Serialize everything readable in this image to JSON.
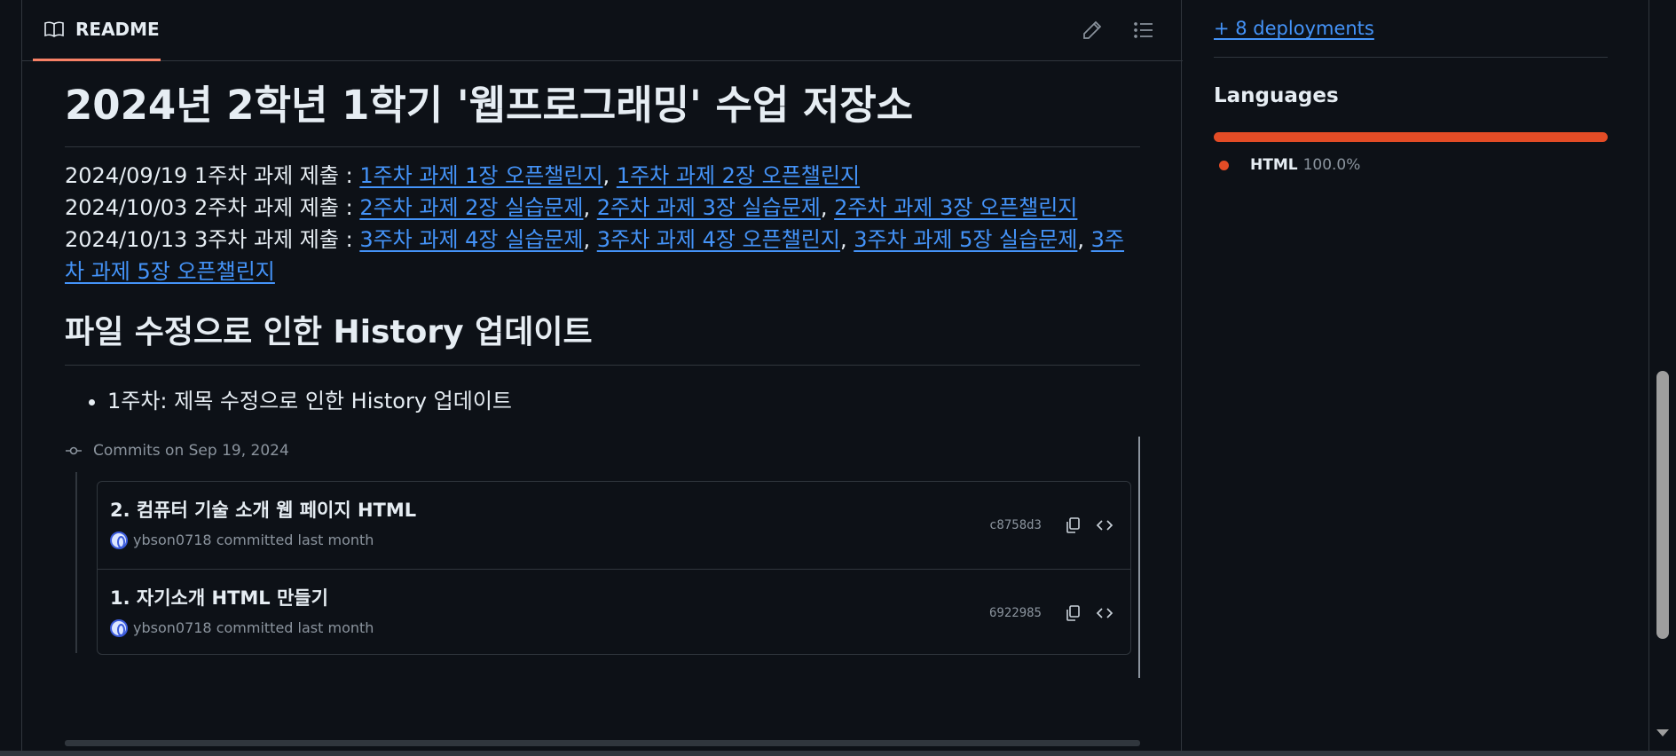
{
  "readme": {
    "tab_label": "README",
    "tab_icon": "book-icon",
    "edit_icon": "pencil-icon",
    "outline_icon": "list-icon"
  },
  "content": {
    "title": "2024년 2학년 1학기 '웹프로그래밍' 수업 저장소",
    "homework": [
      {
        "prefix": "2024/09/19 1주차 과제 제출 : ",
        "links": [
          "1주차 과제 1장 오픈챌린지",
          "1주차 과제 2장 오픈챌린지"
        ]
      },
      {
        "prefix": "2024/10/03 2주차 과제 제출 : ",
        "links": [
          "2주차 과제 2장 실습문제",
          "2주차 과제 3장 실습문제",
          "2주차 과제 3장 오픈챌린지"
        ]
      },
      {
        "prefix": "2024/10/13 3주차 과제 제출 : ",
        "links": [
          "3주차 과제 4장 실습문제",
          "3주차 과제 4장 오픈챌린지",
          "3주차 과제 5장 실습문제",
          "3주차 과제 5장 오픈챌린지"
        ]
      }
    ],
    "history_heading": "파일 수정으로 인한 History 업데이트",
    "history_items": [
      "1주차: 제목 수정으로 인한 History 업데이트"
    ]
  },
  "commits": {
    "header": "Commits on Sep 19, 2024",
    "items": [
      {
        "title": "2. 컴퓨터 기술 소개 웹 페이지 HTML",
        "meta": "ybson0718 committed last month",
        "sha": "c8758d3"
      },
      {
        "title": "1. 자기소개 HTML 만들기",
        "meta": "ybson0718 committed last month",
        "sha": "6922985"
      }
    ]
  },
  "sidebar": {
    "deployments_link": "+ 8 deployments",
    "languages_title": "Languages",
    "languages": [
      {
        "name": "HTML",
        "percent": "100.0%",
        "share": 1.0,
        "color": "#e34c26"
      }
    ]
  },
  "colors": {
    "background": "#0d1117",
    "link": "#4493f8",
    "border": "#30363d",
    "muted": "#8b949e",
    "tab_underline": "#f78166"
  }
}
